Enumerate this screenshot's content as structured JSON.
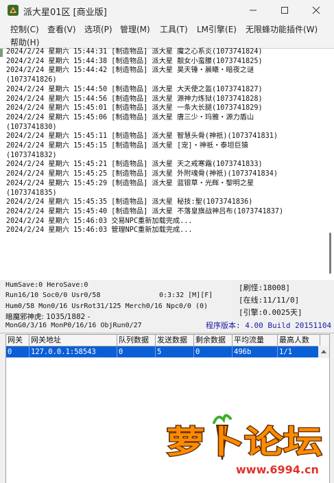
{
  "window": {
    "title": "派大星01区 [商业版]",
    "controls": {
      "minimize": "—",
      "maximize": "☐",
      "close": "✕"
    }
  },
  "menu": {
    "items": [
      "控制(C)",
      "查看(V)",
      "选项(P)",
      "管理(M)",
      "工具(T)",
      "LM引擎(E)",
      "无限蜂功能插件(W)",
      "帮助(H)"
    ]
  },
  "log": {
    "lines": [
      "2024/2/24 星期六 15:44:31 [制造物品] 派大星 魔之心系炎(1073741824)",
      "2024/2/24 星期六 15:44:38 [制造物品] 派大星 靓女小蛮腰(1073741825)",
      "2024/2/24 星期六 15:44:42 [制造物品] 派大星 昊天锤・晨曦・暗夜之谜",
      "(1073741826)",
      "2024/2/24 星期六 15:44:50 [制造物品] 派大星 大天使之盔(1073741827)",
      "2024/2/24 星期六 15:44:56 [制造物品] 派大星 源神力炼狱(1073741828)",
      "2024/2/24 星期六 15:45:01 [制造物品] 派大星 一条大长腿(1073741829)",
      "2024/2/24 星期六 15:45:06 [制造物品] 派大星 唐三少・玛雅・源力盾山",
      "(1073741830)",
      "2024/2/24 星期六 15:45:11 [制造物品] 派大星 智慧头骨(神祇)(1073741831)",
      "2024/2/24 星期六 15:45:15 [制造物品] 派大星 [宠]・神祇・泰坦巨猿",
      "(1073741832)",
      "2024/2/24 星期六 15:45:21 [制造物品] 派大星 天之戒寒霜(1073741833)",
      "2024/2/24 星期六 15:45:25 [制造物品] 派大星 外附魂骨(神祇)(1073741834)",
      "2024/2/24 星期六 15:45:29 [制造物品] 派大星 蓝银草・光辉・黎明之星",
      "(1073741835)",
      "2024/2/24 星期六 15:45:35 [制造物品] 派大星 秘技:聖(1073741836)",
      "2024/2/24 星期六 15:45:40 [制造物品] 派大星 不落皇旗战神吕布(1073741837)",
      "2024/2/24 星期六 15:46:03 交易NPC重新加载完成...",
      "2024/2/24 星期六 15:46:03 管理NPC重新加载完成..."
    ]
  },
  "status": {
    "line1": "HumSave:0 HeroSave:0",
    "line2_left": "Run16/10 Soc0/0 Usr0/58",
    "line2_time": "0:3:32 [M][F]",
    "line3": "Hum0/58 Mon0/16 UsrRot31/125 Merch0/16 Npc0/0 (0)",
    "line4": "暗魔邪神虎: 1035/1882 -",
    "line5": "MonG0/3/16 MonP0/16/16 ObjRun0/27",
    "refresh": "[刷怪:18008]",
    "online": "[在线:11/11/0]",
    "engine": "[引擎:0.0025天]",
    "version": "程序版本: 4.00 Build 20151104"
  },
  "grid": {
    "headers": [
      "网关",
      "网关地址",
      "队列数据",
      "发送数据",
      "剩余数据",
      "平均流量",
      "最高人数"
    ],
    "rows": [
      [
        "0",
        "127.0.0.1:58543",
        "0",
        "5",
        "0",
        "496b",
        "1/1"
      ]
    ]
  },
  "watermark": {
    "text": "萝卜论坛",
    "url": "www.6994.cn"
  },
  "colors": {
    "selection": "#0a5fd7",
    "version_text": "#1a1aa8",
    "watermark_orange": "#ff8a00",
    "watermark_red": "#e0332b"
  }
}
